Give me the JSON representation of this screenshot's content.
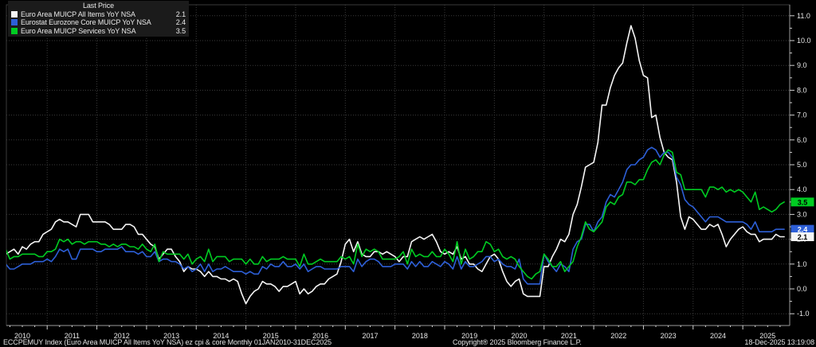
{
  "legend": {
    "title": "Last Price",
    "series_rows": [
      {
        "label": "Euro Area MUICP All Items YoY NSA",
        "value": "2.1",
        "color": "#F5F5F5"
      },
      {
        "label": "Eurostat Eurozone Core MUICP YoY NSA",
        "value": "2.4",
        "color": "#2D5FD7"
      },
      {
        "label": "Euro Area MUICP Services YoY NSA",
        "value": "3.5",
        "color": "#00CC22"
      }
    ]
  },
  "footer": {
    "left": "ECCPEMUY Index (Euro Area MUICP All Items YoY NSA) ez cpi & core Monthly 01JAN2010-31DEC2025",
    "copyright": "Copyright® 2025 Bloomberg Finance L.P.",
    "timestamp": "18-Dec-2025 13:19:08"
  },
  "chart_data": {
    "type": "line",
    "title": "",
    "xlabel": "",
    "ylabel": "",
    "frequency": "monthly",
    "x_start": "2010-01",
    "x_end": "2025-11",
    "x_year_labels": [
      "2010",
      "2011",
      "2012",
      "2013",
      "2014",
      "2015",
      "2016",
      "2017",
      "2018",
      "2019",
      "2020",
      "2021",
      "2022",
      "2023",
      "2024",
      "2025"
    ],
    "ylim": [
      -1.5,
      11.4
    ],
    "y_ticks": [
      -1,
      0,
      1,
      2,
      3,
      4,
      5,
      6,
      7,
      8,
      9,
      10,
      11
    ],
    "grid": {
      "horizontal": "every 1.0, dotted",
      "vertical": "every year, dotted",
      "color": "#3b3b3b"
    },
    "legend_position": "top-left",
    "axis_side": "right",
    "background": "#000000",
    "last_price_badges": [
      {
        "label": "3.5",
        "value": 3.5,
        "bg": "#00CC22",
        "fg": "#000000"
      },
      {
        "label": "2.4",
        "value": 2.4,
        "bg": "#2D5FD7",
        "fg": "#FFFFFF"
      },
      {
        "label": "2.1",
        "value": 2.1,
        "bg": "#F5F5F5",
        "fg": "#000000"
      }
    ],
    "series": [
      {
        "name": "Euro Area MUICP All Items YoY NSA",
        "color": "#F5F5F5",
        "last": 2.1,
        "values": [
          0.9,
          0.8,
          1.4,
          1.5,
          1.6,
          1.4,
          1.7,
          1.6,
          1.8,
          1.9,
          1.9,
          2.2,
          2.3,
          2.4,
          2.7,
          2.8,
          2.7,
          2.7,
          2.6,
          2.5,
          3.0,
          3.0,
          3.0,
          2.7,
          2.7,
          2.7,
          2.7,
          2.6,
          2.4,
          2.4,
          2.4,
          2.6,
          2.6,
          2.5,
          2.2,
          2.2,
          2.0,
          1.8,
          1.7,
          1.2,
          1.4,
          1.6,
          1.6,
          1.3,
          1.1,
          0.7,
          0.9,
          0.8,
          0.8,
          0.7,
          0.5,
          0.7,
          0.5,
          0.5,
          0.4,
          0.4,
          0.3,
          0.4,
          0.3,
          -0.2,
          -0.6,
          -0.3,
          -0.1,
          0.0,
          0.3,
          0.2,
          0.2,
          0.1,
          -0.1,
          0.1,
          0.1,
          0.2,
          0.3,
          -0.2,
          0.0,
          -0.2,
          -0.1,
          0.1,
          0.2,
          0.2,
          0.4,
          0.5,
          0.6,
          1.1,
          1.8,
          2.0,
          1.5,
          1.9,
          1.4,
          1.3,
          1.3,
          1.5,
          1.5,
          1.4,
          1.5,
          1.4,
          1.3,
          1.1,
          1.3,
          1.3,
          1.9,
          2.0,
          2.1,
          2.0,
          2.1,
          2.2,
          1.9,
          1.5,
          1.4,
          1.5,
          1.4,
          1.7,
          1.2,
          1.3,
          1.0,
          1.0,
          0.8,
          0.7,
          1.0,
          1.3,
          1.4,
          1.2,
          0.7,
          0.3,
          0.1,
          0.3,
          0.4,
          -0.2,
          -0.3,
          -0.3,
          -0.3,
          -0.3,
          0.9,
          0.9,
          1.3,
          1.6,
          2.0,
          1.9,
          2.2,
          3.0,
          3.4,
          4.1,
          4.9,
          5.0,
          5.1,
          5.9,
          7.4,
          7.4,
          8.1,
          8.6,
          8.9,
          9.1,
          9.9,
          10.6,
          10.1,
          9.2,
          8.6,
          8.5,
          6.9,
          7.0,
          6.1,
          5.5,
          5.3,
          5.2,
          4.3,
          2.9,
          2.4,
          2.9,
          2.8,
          2.6,
          2.4,
          2.4,
          2.6,
          2.5,
          2.6,
          2.2,
          1.7,
          2.0,
          2.2,
          2.4,
          2.5,
          2.3,
          2.2,
          2.2,
          1.9,
          2.0,
          2.0,
          2.0,
          2.2,
          2.1,
          2.1
        ]
      },
      {
        "name": "Eurostat Eurozone Core MUICP YoY NSA",
        "color": "#2D5FD7",
        "last": 2.4,
        "values": [
          0.9,
          0.8,
          1.0,
          0.8,
          0.8,
          0.9,
          1.0,
          1.0,
          1.0,
          1.1,
          1.1,
          1.1,
          1.2,
          1.1,
          1.3,
          1.6,
          1.5,
          1.6,
          1.2,
          1.2,
          1.6,
          1.6,
          1.6,
          1.6,
          1.5,
          1.5,
          1.6,
          1.6,
          1.6,
          1.6,
          1.7,
          1.5,
          1.5,
          1.5,
          1.4,
          1.5,
          1.3,
          1.3,
          1.5,
          1.1,
          1.2,
          1.2,
          1.1,
          1.1,
          1.0,
          0.8,
          0.9,
          0.7,
          0.8,
          1.0,
          0.7,
          1.0,
          0.7,
          0.8,
          0.8,
          0.9,
          0.8,
          0.7,
          0.7,
          0.7,
          0.6,
          0.7,
          0.6,
          0.6,
          0.9,
          0.8,
          1.0,
          0.9,
          0.9,
          1.1,
          0.9,
          0.9,
          1.0,
          0.8,
          1.0,
          0.7,
          0.8,
          0.9,
          0.9,
          0.8,
          0.8,
          0.8,
          0.8,
          0.9,
          0.9,
          0.9,
          0.7,
          1.2,
          0.9,
          1.1,
          1.2,
          1.2,
          1.1,
          0.9,
          0.9,
          0.9,
          1.0,
          1.0,
          1.0,
          0.8,
          1.1,
          0.9,
          1.1,
          0.9,
          0.9,
          1.1,
          1.0,
          0.9,
          1.1,
          1.0,
          0.8,
          1.3,
          0.8,
          1.1,
          0.9,
          0.9,
          1.0,
          1.1,
          1.3,
          1.3,
          1.1,
          1.2,
          1.0,
          0.9,
          0.9,
          0.8,
          1.2,
          0.4,
          0.2,
          0.2,
          0.2,
          0.2,
          1.4,
          1.1,
          0.9,
          0.7,
          1.0,
          0.9,
          0.7,
          1.6,
          1.9,
          2.0,
          2.6,
          2.6,
          2.3,
          2.7,
          2.9,
          3.5,
          3.8,
          3.7,
          4.0,
          4.3,
          4.8,
          5.0,
          5.0,
          5.2,
          5.3,
          5.6,
          5.7,
          5.6,
          5.3,
          5.5,
          5.5,
          5.3,
          4.5,
          4.2,
          3.6,
          3.4,
          3.3,
          3.1,
          2.9,
          2.7,
          2.9,
          2.9,
          2.9,
          2.8,
          2.7,
          2.7,
          2.7,
          2.7,
          2.7,
          2.6,
          2.4,
          2.7,
          2.3,
          2.3,
          2.3,
          2.3,
          2.4,
          2.4,
          2.4
        ]
      },
      {
        "name": "Euro Area MUICP Services YoY NSA",
        "color": "#00CC22",
        "last": 3.5,
        "values": [
          1.4,
          1.3,
          1.6,
          1.2,
          1.3,
          1.3,
          1.4,
          1.4,
          1.4,
          1.4,
          1.3,
          1.3,
          1.5,
          1.5,
          1.6,
          2.0,
          1.9,
          2.0,
          1.8,
          1.9,
          1.9,
          1.8,
          1.9,
          1.9,
          1.9,
          1.8,
          1.8,
          1.7,
          1.8,
          1.7,
          1.8,
          1.8,
          1.7,
          1.7,
          1.6,
          1.8,
          1.6,
          1.5,
          1.8,
          1.1,
          1.5,
          1.4,
          1.4,
          1.4,
          1.4,
          1.2,
          1.4,
          1.0,
          1.2,
          1.3,
          1.1,
          1.6,
          1.1,
          1.3,
          1.3,
          1.3,
          1.1,
          1.2,
          1.2,
          1.2,
          1.0,
          1.2,
          1.0,
          1.0,
          1.3,
          1.1,
          1.2,
          1.2,
          1.2,
          1.3,
          1.2,
          1.2,
          1.2,
          0.9,
          1.4,
          1.0,
          1.0,
          1.1,
          1.2,
          1.1,
          1.1,
          1.1,
          1.1,
          1.3,
          1.2,
          1.3,
          1.0,
          1.8,
          1.3,
          1.6,
          1.5,
          1.6,
          1.5,
          1.2,
          1.2,
          1.2,
          1.2,
          1.3,
          1.5,
          1.0,
          1.6,
          1.3,
          1.4,
          1.3,
          1.3,
          1.5,
          1.3,
          1.3,
          1.6,
          1.4,
          1.1,
          1.9,
          1.0,
          1.6,
          1.2,
          1.3,
          1.5,
          1.5,
          1.9,
          1.8,
          1.5,
          1.6,
          1.3,
          1.2,
          1.3,
          1.2,
          0.9,
          0.7,
          0.5,
          0.4,
          0.6,
          0.7,
          1.4,
          1.2,
          0.9,
          0.9,
          1.1,
          0.7,
          0.9,
          1.1,
          1.7,
          2.1,
          2.7,
          2.4,
          2.3,
          2.5,
          2.7,
          3.3,
          3.5,
          3.4,
          3.7,
          3.8,
          4.3,
          4.3,
          4.2,
          4.4,
          4.4,
          4.8,
          5.1,
          5.2,
          5.0,
          5.4,
          5.6,
          5.5,
          4.7,
          4.6,
          4.0,
          4.0,
          4.0,
          4.0,
          4.0,
          3.7,
          4.1,
          4.1,
          4.0,
          4.1,
          3.9,
          4.0,
          3.9,
          4.0,
          3.9,
          3.7,
          3.5,
          3.9,
          3.2,
          3.3,
          3.2,
          3.1,
          3.2,
          3.4,
          3.5
        ]
      }
    ]
  }
}
